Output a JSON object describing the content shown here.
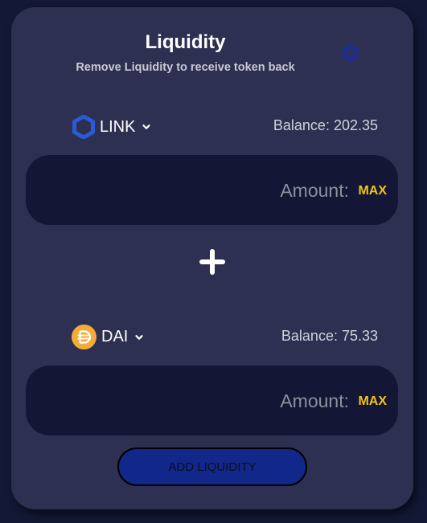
{
  "header": {
    "title": "Liquidity",
    "subtitle": "Remove Liquidity to receive token back",
    "settings_icon": "gear-icon"
  },
  "token_a": {
    "symbol": "LINK",
    "icon": "link-hexagon-icon",
    "balance_text": "Balance: 202.35",
    "amount_placeholder": "Amount:",
    "max_label": "MAX"
  },
  "token_b": {
    "symbol": "DAI",
    "icon": "dai-coin-icon",
    "balance_text": "Balance: 75.33",
    "amount_placeholder": "Amount:",
    "max_label": "MAX"
  },
  "separator_icon": "plus-icon",
  "actions": {
    "add_liquidity_label": "ADD LIQUIDITY"
  },
  "colors": {
    "background": "#131836",
    "card": "#2d3051",
    "input_bg": "#131735",
    "accent": "#12278a",
    "link_blue": "#2a5ada",
    "dai_yellow": "#f5ac37",
    "max_yellow": "#f5c31a"
  }
}
